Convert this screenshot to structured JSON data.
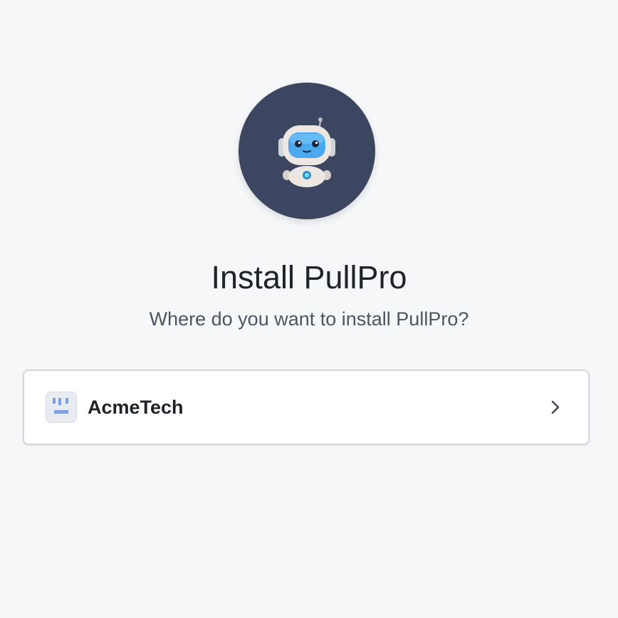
{
  "app": {
    "avatar_icon": "robot-icon",
    "avatar_bg": "#3d4660"
  },
  "header": {
    "title": "Install PullPro",
    "subtitle": "Where do you want to install PullPro?"
  },
  "accounts": [
    {
      "name": "AcmeTech",
      "avatar_icon": "identicon-icon",
      "action_icon": "chevron-right-icon"
    }
  ]
}
